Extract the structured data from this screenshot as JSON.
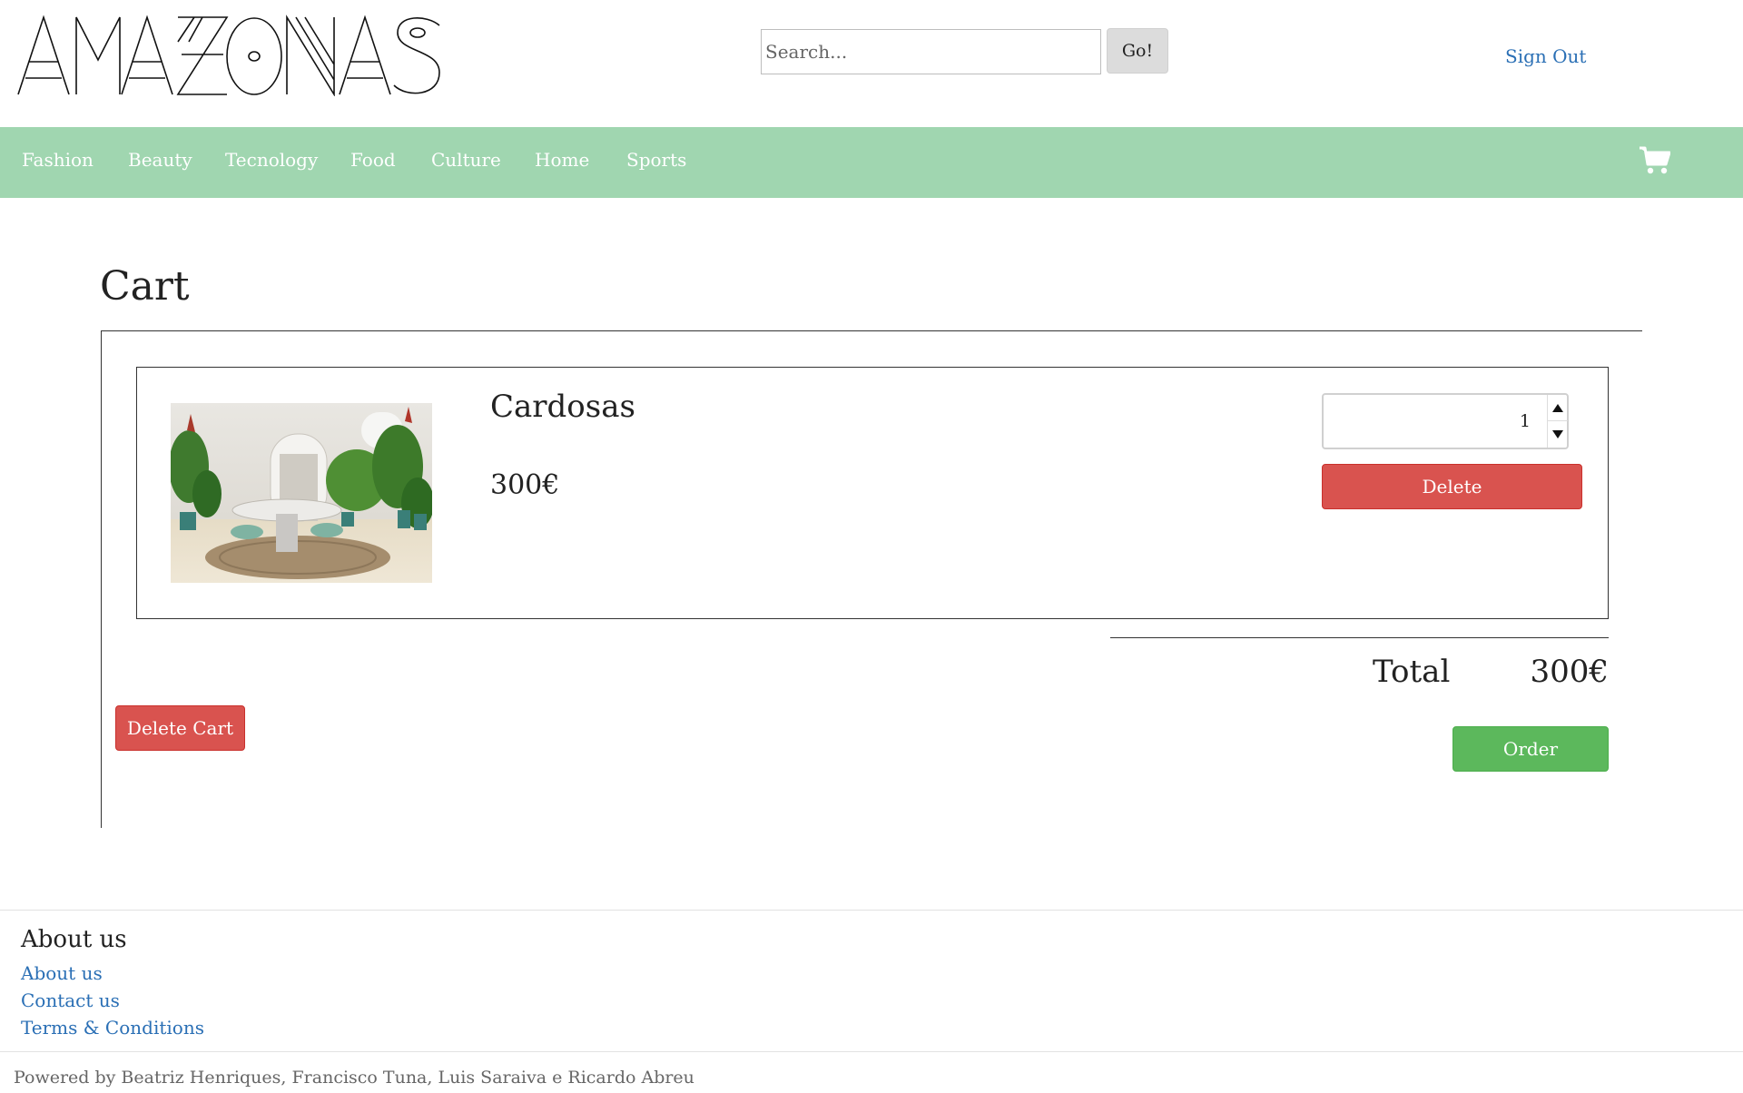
{
  "header": {
    "logo_text": "AMAZONAS",
    "search_placeholder": "Search...",
    "search_button": "Go!",
    "signout": "Sign Out"
  },
  "nav": {
    "items": [
      "Fashion",
      "Beauty",
      "Tecnology",
      "Food",
      "Culture",
      "Home",
      "Sports"
    ],
    "cart_icon": "shopping-cart-icon"
  },
  "cart": {
    "title": "Cart",
    "items": [
      {
        "name": "Cardosas",
        "price": "300€",
        "quantity": "1",
        "image": "interior-dining-room-photo",
        "delete_label": "Delete"
      }
    ],
    "total_label": "Total",
    "total_value": "300€",
    "delete_cart_label": "Delete Cart",
    "order_label": "Order"
  },
  "footer": {
    "heading": "About us",
    "links": [
      "About us",
      "Contact us",
      "Terms & Conditions"
    ],
    "credits": "Powered by Beatriz Henriques, Francisco Tuna, Luis Saraiva e Ricardo Abreu"
  },
  "colors": {
    "nav_bg": "#a0d6b0",
    "link": "#2a6fb5",
    "danger": "#d9534f",
    "success": "#5cb85c"
  }
}
